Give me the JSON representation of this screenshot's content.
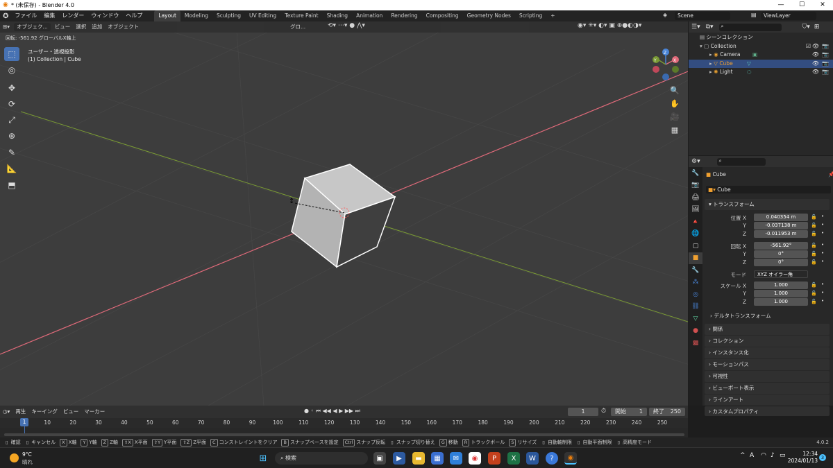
{
  "titlebar": {
    "title": "* (未保存) - Blender 4.0",
    "minimize": "—",
    "maximize": "☐",
    "close": "✕"
  },
  "menubar": {
    "menus": [
      "ファイル",
      "編集",
      "レンダー",
      "ウィンドウ",
      "ヘルプ"
    ],
    "workspaces": [
      "Layout",
      "Modeling",
      "Sculpting",
      "UV Editing",
      "Texture Paint",
      "Shading",
      "Animation",
      "Rendering",
      "Compositing",
      "Geometry Nodes",
      "Scripting"
    ],
    "add_workspace": "+",
    "scene": "Scene",
    "viewlayer": "ViewLayer"
  },
  "viewport": {
    "mode": "オブジェク...",
    "menus": [
      "ビュー",
      "選択",
      "追加",
      "オブジェクト"
    ],
    "orientation": "グロ...",
    "status": "回転: -561.92 グローバルX軸上",
    "view_name": "ユーザー・透視投影",
    "collection_info": "(1) Collection | Cube",
    "gizmo": {
      "x": "X",
      "y": "Y",
      "z": "Z"
    }
  },
  "outliner": {
    "search_placeholder": "",
    "rows": [
      {
        "label": "シーンコレクション",
        "indent": 0
      },
      {
        "label": "Collection",
        "indent": 1
      },
      {
        "label": "Camera",
        "indent": 2
      },
      {
        "label": "Cube",
        "indent": 2
      },
      {
        "label": "Light",
        "indent": 2
      }
    ]
  },
  "properties": {
    "object_name": "Cube",
    "data_name": "Cube",
    "transform_title": "トランスフォーム",
    "location_label": "位置 X",
    "location": {
      "x": "0.040354 m",
      "y": "-0.037138 m",
      "z": "-0.011953 m"
    },
    "rotation_label": "回転 X",
    "rotation": {
      "x": "-561.92°",
      "y": "0°",
      "z": "0°"
    },
    "mode_label": "モード",
    "mode_value": "XYZ オイラー角",
    "scale_label": "スケール X",
    "scale": {
      "x": "1.000",
      "y": "1.000",
      "z": "1.000"
    },
    "axis_y": "Y",
    "axis_z": "Z",
    "delta": "デルタトランスフォーム",
    "panels": [
      "関係",
      "コレクション",
      "インスタンス化",
      "モーションパス",
      "可視性",
      "ビューポート表示",
      "ラインアート",
      "カスタムプロパティ"
    ]
  },
  "timeline": {
    "menus": [
      "再生",
      "キーイング",
      "ビュー",
      "マーカー"
    ],
    "current_frame": "1",
    "start_label": "開始",
    "start": "1",
    "end_label": "終了",
    "end": "250",
    "ticks": [
      "1",
      "10",
      "20",
      "30",
      "40",
      "50",
      "60",
      "70",
      "80",
      "90",
      "100",
      "110",
      "120",
      "130",
      "140",
      "150",
      "160",
      "170",
      "180",
      "190",
      "200",
      "210",
      "220",
      "230",
      "240",
      "250"
    ]
  },
  "statusbar": {
    "items": [
      {
        "key": "",
        "label": "確認"
      },
      {
        "key": "",
        "label": "キャンセル"
      },
      {
        "key": "X",
        "label": "X軸"
      },
      {
        "key": "Y",
        "label": "Y軸"
      },
      {
        "key": "Z",
        "label": "Z軸"
      },
      {
        "key": "⇧X",
        "label": "X平面"
      },
      {
        "key": "⇧Y",
        "label": "Y平面"
      },
      {
        "key": "⇧Z",
        "label": "Z平面"
      },
      {
        "key": "C",
        "label": "コンストレイントをクリア"
      },
      {
        "key": "B",
        "label": "スナップベースを設定"
      },
      {
        "key": "Ctrl",
        "label": "スナップ反転"
      },
      {
        "key": "",
        "label": "スナップ切り替え"
      },
      {
        "key": "G",
        "label": "移動"
      },
      {
        "key": "R",
        "label": "トラックボール"
      },
      {
        "key": "S",
        "label": "リサイズ"
      },
      {
        "key": "",
        "label": "自動軸制限"
      },
      {
        "key": "",
        "label": "自動平面制限"
      },
      {
        "key": "",
        "label": "高精度モード"
      }
    ],
    "version": "4.0.2"
  },
  "taskbar": {
    "weather_temp": "9°C",
    "weather_desc": "晴れ",
    "search": "検索",
    "time": "12:34",
    "date": "2024/01/13",
    "ime": "A",
    "notifications": "3"
  },
  "colors": {
    "accent": "#4772b3",
    "x_axis": "#e06a7a",
    "y_axis": "#7a9a35",
    "viewport_bg": "#3d3d3d"
  }
}
